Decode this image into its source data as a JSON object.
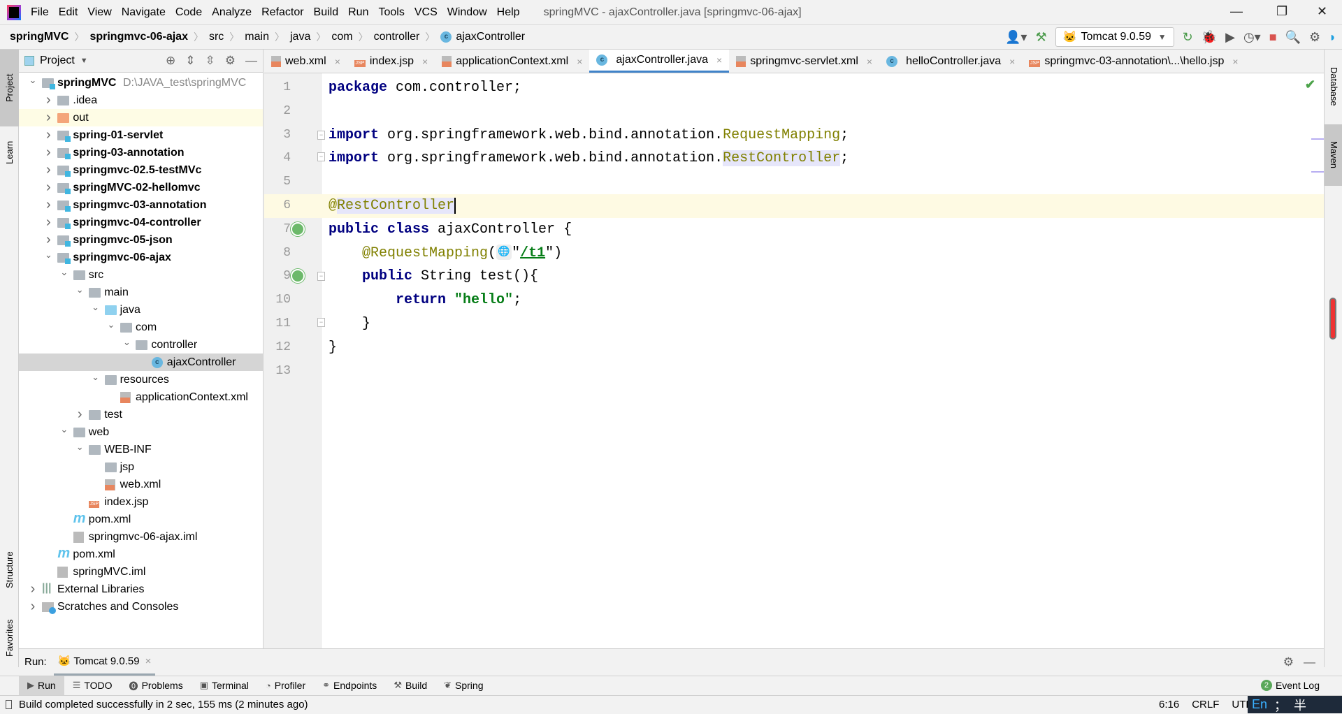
{
  "menu": [
    "File",
    "Edit",
    "View",
    "Navigate",
    "Code",
    "Analyze",
    "Refactor",
    "Build",
    "Run",
    "Tools",
    "VCS",
    "Window",
    "Help"
  ],
  "window_title": "springMVC - ajaxController.java [springmvc-06-ajax]",
  "breadcrumb": [
    "springMVC",
    "springmvc-06-ajax",
    "src",
    "main",
    "java",
    "com",
    "controller",
    "ajaxController"
  ],
  "run_config": "Tomcat 9.0.59",
  "project_panel": {
    "title": "Project",
    "root_path": "D:\\JAVA_test\\springMVC"
  },
  "tree": [
    {
      "label": "springMVC",
      "level": 0,
      "chev": "v",
      "icon": "module-folder",
      "bold": true
    },
    {
      "label": ".idea",
      "level": 1,
      "chev": ">",
      "icon": "folder"
    },
    {
      "label": "out",
      "level": 1,
      "chev": ">",
      "icon": "orange-folder",
      "hl": true
    },
    {
      "label": "spring-01-servlet",
      "level": 1,
      "chev": ">",
      "icon": "module-folder",
      "bold": true
    },
    {
      "label": "spring-03-annotation",
      "level": 1,
      "chev": ">",
      "icon": "module-folder",
      "bold": true
    },
    {
      "label": "springmvc-02.5-testMVc",
      "level": 1,
      "chev": ">",
      "icon": "module-folder",
      "bold": true
    },
    {
      "label": "springMVC-02-hellomvc",
      "level": 1,
      "chev": ">",
      "icon": "module-folder",
      "bold": true
    },
    {
      "label": "springmvc-03-annotation",
      "level": 1,
      "chev": ">",
      "icon": "module-folder",
      "bold": true
    },
    {
      "label": "springmvc-04-controller",
      "level": 1,
      "chev": ">",
      "icon": "module-folder",
      "bold": true
    },
    {
      "label": "springmvc-05-json",
      "level": 1,
      "chev": ">",
      "icon": "module-folder",
      "bold": true
    },
    {
      "label": "springmvc-06-ajax",
      "level": 1,
      "chev": "v",
      "icon": "module-folder",
      "bold": true
    },
    {
      "label": "src",
      "level": 2,
      "chev": "v",
      "icon": "folder"
    },
    {
      "label": "main",
      "level": 3,
      "chev": "v",
      "icon": "folder"
    },
    {
      "label": "java",
      "level": 4,
      "chev": "v",
      "icon": "source-folder"
    },
    {
      "label": "com",
      "level": 5,
      "chev": "v",
      "icon": "package"
    },
    {
      "label": "controller",
      "level": 6,
      "chev": "v",
      "icon": "package"
    },
    {
      "label": "ajaxController",
      "level": 7,
      "chev": "",
      "icon": "class",
      "sel": true
    },
    {
      "label": "resources",
      "level": 4,
      "chev": "v",
      "icon": "resources-folder"
    },
    {
      "label": "applicationContext.xml",
      "level": 5,
      "chev": "",
      "icon": "spring-xml"
    },
    {
      "label": "test",
      "level": 3,
      "chev": ">",
      "icon": "folder"
    },
    {
      "label": "web",
      "level": 2,
      "chev": "v",
      "icon": "web-folder"
    },
    {
      "label": "WEB-INF",
      "level": 3,
      "chev": "v",
      "icon": "folder"
    },
    {
      "label": "jsp",
      "level": 4,
      "chev": "",
      "icon": "folder"
    },
    {
      "label": "web.xml",
      "level": 4,
      "chev": "",
      "icon": "xml-file"
    },
    {
      "label": "index.jsp",
      "level": 3,
      "chev": "",
      "icon": "jsp-file"
    },
    {
      "label": "pom.xml",
      "level": 2,
      "chev": "",
      "icon": "maven"
    },
    {
      "label": "springmvc-06-ajax.iml",
      "level": 2,
      "chev": "",
      "icon": "iml-file"
    },
    {
      "label": "pom.xml",
      "level": 1,
      "chev": "",
      "icon": "maven"
    },
    {
      "label": "springMVC.iml",
      "level": 1,
      "chev": "",
      "icon": "iml-file"
    },
    {
      "label": "External Libraries",
      "level": 0,
      "chev": ">",
      "icon": "libraries"
    },
    {
      "label": "Scratches and Consoles",
      "level": 0,
      "chev": ">",
      "icon": "scratches"
    }
  ],
  "tabs": [
    {
      "label": "web.xml",
      "icon": "xml"
    },
    {
      "label": "index.jsp",
      "icon": "jsp"
    },
    {
      "label": "applicationContext.xml",
      "icon": "xml"
    },
    {
      "label": "ajaxController.java",
      "icon": "class",
      "active": true
    },
    {
      "label": "springmvc-servlet.xml",
      "icon": "xml"
    },
    {
      "label": "helloController.java",
      "icon": "class"
    },
    {
      "label": "springmvc-03-annotation\\...\\hello.jsp",
      "icon": "jsp"
    }
  ],
  "code": [
    [
      {
        "t": "package",
        "c": "k"
      },
      {
        "t": " com.controller;"
      }
    ],
    [],
    [
      {
        "t": "import",
        "c": "k"
      },
      {
        "t": " org.springframework.web.bind.annotation."
      },
      {
        "t": "RequestMapping",
        "c": "an"
      },
      {
        "t": ";"
      }
    ],
    [
      {
        "t": "import",
        "c": "k"
      },
      {
        "t": " org.springframework.web.bind.annotation."
      },
      {
        "t": "RestController",
        "c": "an ref"
      },
      {
        "t": ";"
      }
    ],
    [],
    [
      {
        "t": "@",
        "c": "an"
      },
      {
        "t": "RestController",
        "c": "an ref caret"
      }
    ],
    [
      {
        "t": "public class",
        "c": "k"
      },
      {
        "t": " ajaxController {"
      }
    ],
    [
      {
        "t": "    "
      },
      {
        "t": "@RequestMapping",
        "c": "an"
      },
      {
        "t": "("
      },
      {
        "t": "globe",
        "c": "globe"
      },
      {
        "t": "\""
      },
      {
        "t": "/t1",
        "c": "s u"
      },
      {
        "t": "\")"
      }
    ],
    [
      {
        "t": "    "
      },
      {
        "t": "public",
        "c": "k"
      },
      {
        "t": " String test(){"
      }
    ],
    [
      {
        "t": "        "
      },
      {
        "t": "return",
        "c": "k"
      },
      {
        "t": " "
      },
      {
        "t": "\"hello\"",
        "c": "s"
      },
      {
        "t": ";"
      }
    ],
    [
      {
        "t": "    }"
      }
    ],
    [
      {
        "t": "}"
      }
    ],
    []
  ],
  "current_line": 6,
  "left_stripe": [
    "Project",
    "Learn",
    "Structure",
    "Favorites"
  ],
  "right_stripe": [
    "Database",
    "Maven"
  ],
  "run_panel": {
    "label": "Run:",
    "tab": "Tomcat 9.0.59"
  },
  "tool_windows": [
    {
      "label": "Run",
      "icon": "run-icon",
      "active": true
    },
    {
      "label": "TODO",
      "icon": "todo-icon"
    },
    {
      "label": "Problems",
      "icon": "problems-icon"
    },
    {
      "label": "Terminal",
      "icon": "terminal-icon"
    },
    {
      "label": "Profiler",
      "icon": "profiler-icon"
    },
    {
      "label": "Endpoints",
      "icon": "endpoints-icon"
    },
    {
      "label": "Build",
      "icon": "build-icon"
    },
    {
      "label": "Spring",
      "icon": "spring-icon"
    }
  ],
  "event_log": {
    "label": "Event Log",
    "count": "2"
  },
  "status": {
    "message": "Build completed successfully in 2 sec, 155 ms (2 minutes ago)",
    "position": "6:16",
    "line_sep": "CRLF",
    "encoding": "UTF"
  },
  "ime": {
    "lang": "En",
    "punct": "；",
    "width": "半"
  },
  "colors": {
    "accent": "#4083c9",
    "keyword": "#000080",
    "annotation": "#808000",
    "string": "#067d17",
    "current_line": "#fefae3"
  }
}
